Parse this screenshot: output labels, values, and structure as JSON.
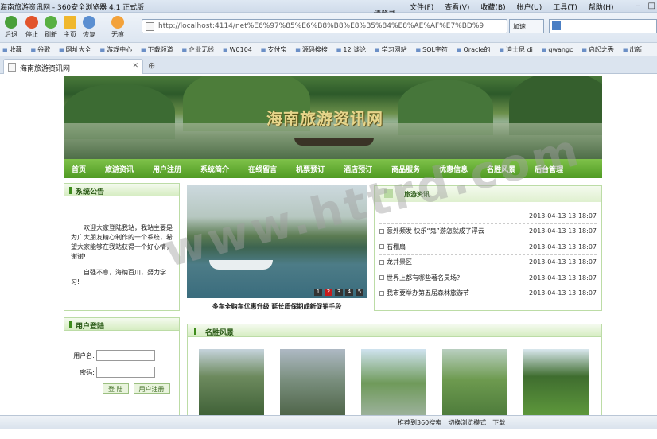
{
  "browser": {
    "window_title": "海南旅游资讯网 - 360安全浏览器 4.1 正式版",
    "menu": [
      "请登录",
      "文件(F)",
      "查看(V)",
      "收藏(B)",
      "帐户(U)",
      "工具(T)",
      "帮助(H)"
    ],
    "nav_buttons": [
      {
        "label": "后退",
        "icon": "back-arrow-icon"
      },
      {
        "label": "停止",
        "icon": "stop-icon"
      },
      {
        "label": "刷新",
        "icon": "refresh-icon"
      },
      {
        "label": "主页",
        "icon": "home-icon"
      },
      {
        "label": "恢复",
        "icon": "undo-icon"
      },
      {
        "label": "无痕",
        "icon": "paw-icon"
      }
    ],
    "url": "http://localhost:4114/net%E6%97%85%E6%B8%B8%E8%B5%84%E8%AE%AF%E7%BD%9",
    "accelerate_label": "加速",
    "bookmarks": [
      "收藏",
      "谷歌",
      "网址大全",
      "游戏中心",
      "下载频道",
      "企业无线",
      "W0104",
      "支付宝",
      "源码搜搜",
      "12 谈论",
      "学习网站",
      "SQL字符",
      "Oracle的",
      "迪士尼 di",
      "qwangc",
      "启起之秀",
      "出新"
    ],
    "tab_title": "海南旅游资讯网",
    "status": [
      "推荐到360搜索",
      "切换浏览模式",
      "下载"
    ]
  },
  "site": {
    "title": "海南旅游资讯网",
    "nav": [
      "首页",
      "旅游资讯",
      "用户注册",
      "系统简介",
      "在线留言",
      "机票预订",
      "酒店预订",
      "商品服务",
      "优惠信息",
      "名胜风景",
      "后台管理"
    ],
    "notice_heading": "系统公告",
    "notice_p1": "欢迎大家登陆我站，我站主要是为广大朋友精心制作的一个系统，希望大家能够在我站获得一个好心情，谢谢!",
    "notice_p2": "自强不息，海纳百川，努力学习!",
    "login_heading": "用户登陆",
    "login_user_label": "用户名:",
    "login_pass_label": "密码:",
    "login_button": "登 陆",
    "register_button": "用户注册",
    "slide_caption": "多车全购车优惠升级 延长质保期成新促销手段",
    "slide_pages": [
      "1",
      "2",
      "3",
      "4",
      "5"
    ],
    "slide_active": 2,
    "news_heading": "旅游资讯",
    "news": [
      {
        "title": "",
        "date": "2013-04-13 13:18:07"
      },
      {
        "title": "意外频发 快乐“鬼”游怎就成了浮云",
        "date": "2013-04-13 13:18:07"
      },
      {
        "title": "石棚扇",
        "date": "2013-04-13 13:18:07"
      },
      {
        "title": "龙井景区",
        "date": "2013-04-13 13:18:07"
      },
      {
        "title": "世界上都有哪些著名灵场？",
        "date": "2013-04-13 13:18:07"
      },
      {
        "title": "我市要举办第五届森林旅游节",
        "date": "2013-04-13 13:18:07"
      }
    ],
    "scenic_heading": "名胜风景"
  },
  "watermark": "www.httrd.com"
}
